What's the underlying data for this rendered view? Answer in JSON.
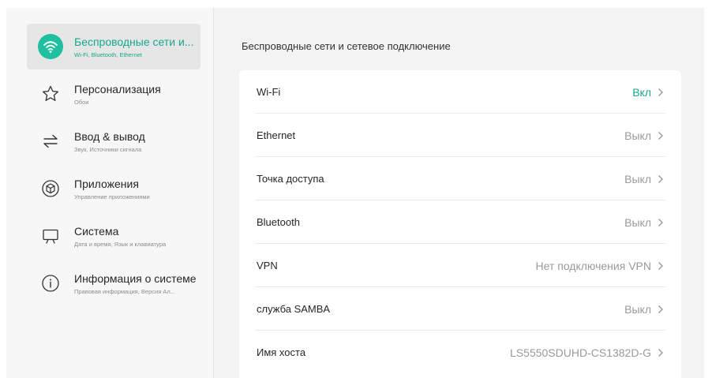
{
  "sidebar": {
    "items": [
      {
        "title": "Беспроводные сети и...",
        "subtitle": "Wi-Fi, Bluetooth, Ethernet",
        "icon": "wifi-icon",
        "active": true
      },
      {
        "title": "Персонализация",
        "subtitle": "Обои",
        "icon": "star-icon"
      },
      {
        "title": "Ввод & вывод",
        "subtitle": "Звук, Источники сигнала",
        "icon": "swap-arrows-icon"
      },
      {
        "title": "Приложения",
        "subtitle": "Управление приложениями",
        "icon": "cube-icon"
      },
      {
        "title": "Система",
        "subtitle": "Дата и время, Язык и клавиатура",
        "icon": "monitor-icon"
      },
      {
        "title": "Информация о системе",
        "subtitle": "Правовая информация, Версия Ал...",
        "icon": "info-icon"
      }
    ]
  },
  "main": {
    "section_title": "Беспроводные сети и сетевое подключение",
    "rows": [
      {
        "label": "Wi-Fi",
        "value": "Вкл"
      },
      {
        "label": "Ethernet",
        "value": "Выкл"
      },
      {
        "label": "Точка доступа",
        "value": "Выкл"
      },
      {
        "label": "Bluetooth",
        "value": "Выкл"
      },
      {
        "label": "VPN",
        "value": "Нет подключения VPN"
      },
      {
        "label": "служба SAMBA",
        "value": "Выкл"
      },
      {
        "label": "Имя хоста",
        "value": "LS5550SDUHD-CS1382D-G"
      }
    ]
  },
  "colors": {
    "accent": "#17a88b",
    "muted": "#9a9a9a",
    "background": "#f3f3f3"
  }
}
